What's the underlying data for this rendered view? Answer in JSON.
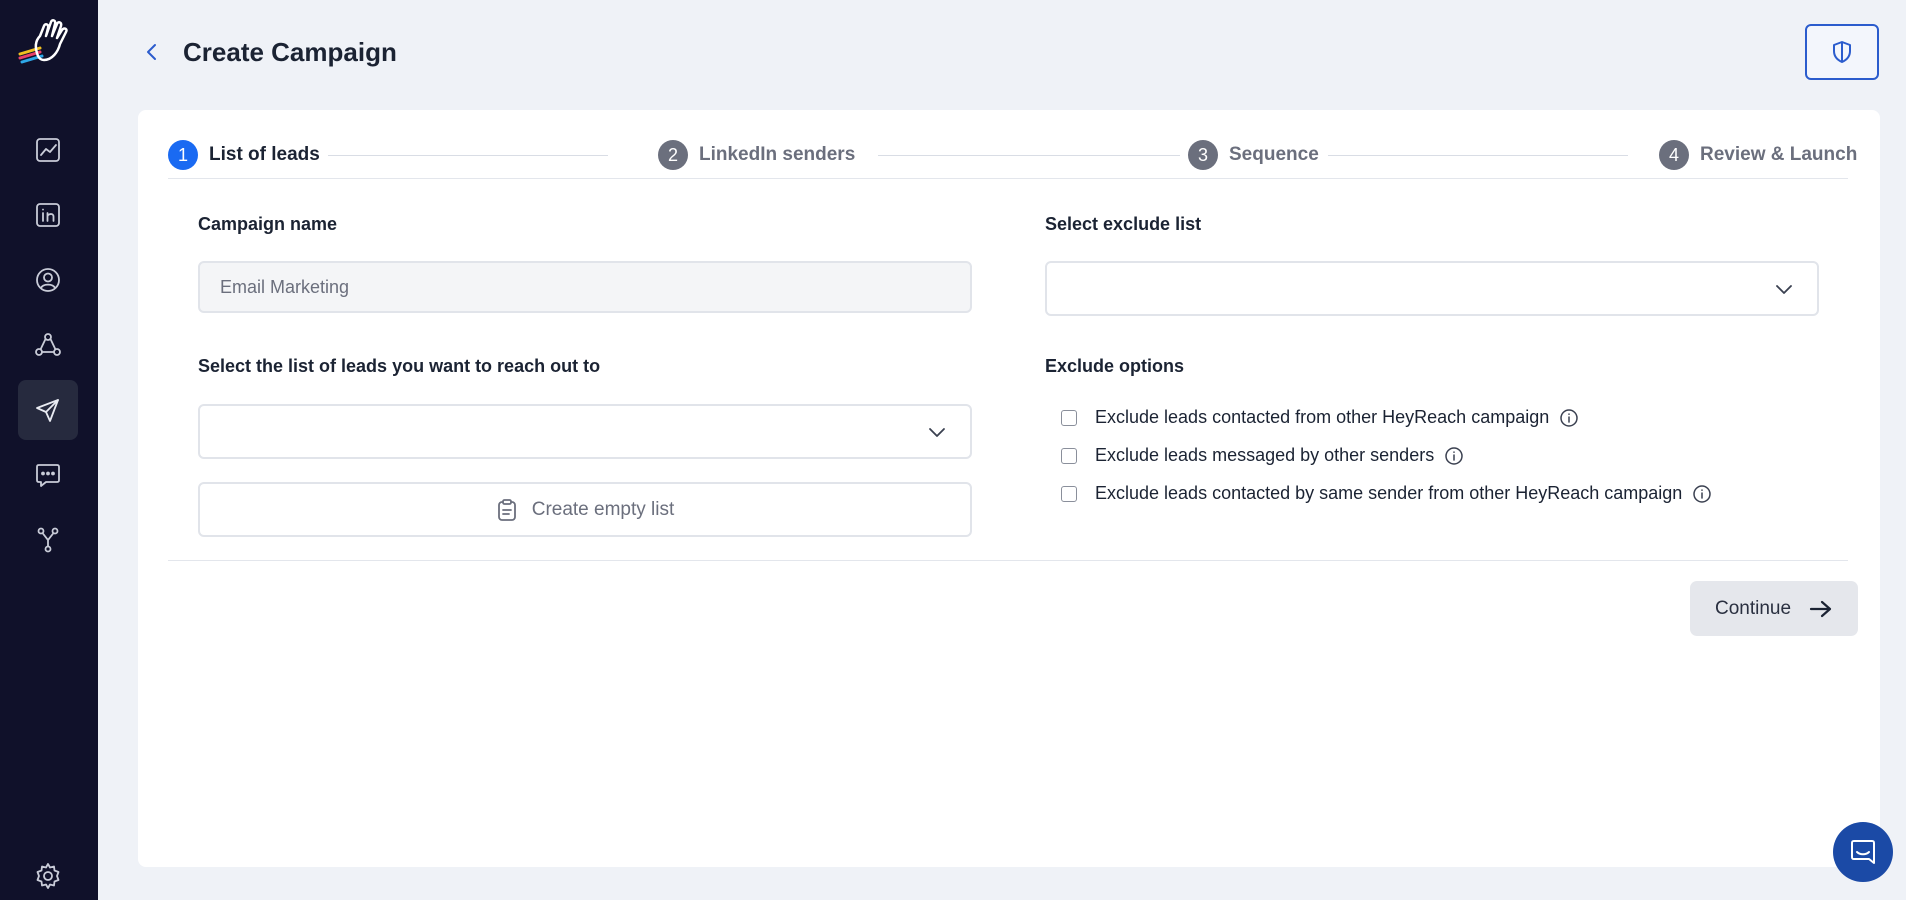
{
  "sidebar": {
    "logo": "heyreach-hand-logo",
    "items": [
      {
        "icon": "analytics-icon",
        "active": false
      },
      {
        "icon": "linkedin-icon",
        "active": false
      },
      {
        "icon": "user-icon",
        "active": false
      },
      {
        "icon": "network-icon",
        "active": false
      },
      {
        "icon": "send-icon",
        "active": true
      },
      {
        "icon": "chat-icon",
        "active": false
      },
      {
        "icon": "integrations-icon",
        "active": false
      }
    ],
    "settings_icon": "gear-icon"
  },
  "header": {
    "title": "Create Campaign",
    "back_icon": "chevron-left-icon",
    "action_icon": "shield-icon"
  },
  "stepper": {
    "steps": [
      {
        "number": "1",
        "label": "List of leads",
        "active": true
      },
      {
        "number": "2",
        "label": "LinkedIn senders",
        "active": false
      },
      {
        "number": "3",
        "label": "Sequence",
        "active": false
      },
      {
        "number": "4",
        "label": "Review & Launch",
        "active": false
      }
    ]
  },
  "form": {
    "campaign_name_label": "Campaign name",
    "campaign_name_value": "Email Marketing",
    "leads_list_label": "Select the list of leads you want to reach out to",
    "leads_list_value": "",
    "create_empty_list_label": "Create empty list",
    "exclude_list_label": "Select exclude list",
    "exclude_list_value": "",
    "exclude_options_label": "Exclude options",
    "exclude_options": [
      {
        "label": "Exclude leads contacted from other HeyReach campaign",
        "checked": false
      },
      {
        "label": "Exclude leads messaged by other senders",
        "checked": false
      },
      {
        "label": "Exclude leads contacted by same sender from other HeyReach campaign",
        "checked": false
      }
    ]
  },
  "footer": {
    "continue_label": "Continue"
  },
  "colors": {
    "sidebar_bg": "#10112a",
    "accent": "#1a6af2",
    "page_bg": "#eff2f7",
    "chat_bubble": "#1b4aa6"
  }
}
